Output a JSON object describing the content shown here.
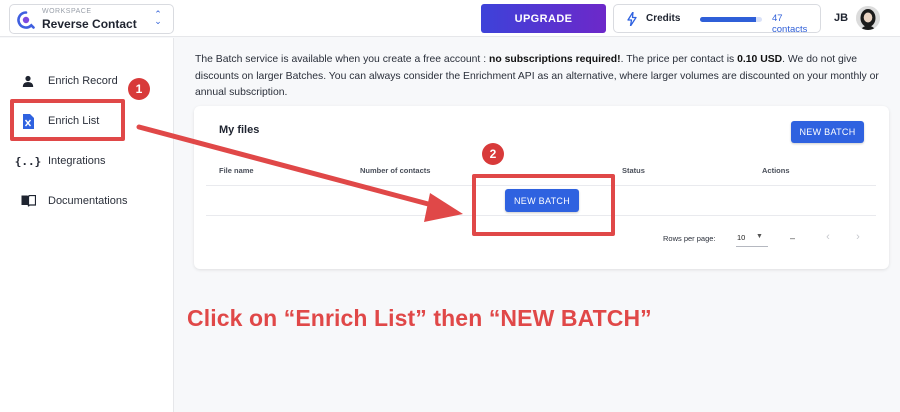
{
  "header": {
    "workspace_label": "WORKSPACE",
    "workspace_name": "Reverse Contact",
    "upgrade_label": "UPGRADE",
    "credits_label": "Credits",
    "credits_count": "47 contacts",
    "credits_progress": 0.9,
    "user_initials": "JB"
  },
  "sidebar": {
    "items": [
      {
        "label": "Enrich Record",
        "icon": "person-icon"
      },
      {
        "label": "Enrich List",
        "icon": "spreadsheet-icon"
      },
      {
        "label": "Integrations",
        "icon": "code-braces-icon"
      },
      {
        "label": "Documentations",
        "icon": "book-icon"
      }
    ]
  },
  "notice": {
    "part1": "The Batch service is available when you create a free account : ",
    "bold1": "no subscriptions required!",
    "part2": ". The price per contact is ",
    "bold2": "0.10 USD",
    "part3": ". We do not give discounts on larger Batches. You can always consider the Enrichment API as an alternative, where larger volumes are discounted on your monthly or annual subscription."
  },
  "files_card": {
    "title": "My files",
    "new_batch_label": "NEW BATCH",
    "columns": [
      "File name",
      "Number of contacts",
      "Status",
      "Actions"
    ],
    "empty_new_batch_label": "NEW BATCH",
    "rows_per_page_label": "Rows per page:",
    "rows_per_page_value": "10",
    "range_text": "–",
    "prev_label": "‹",
    "next_label": "›"
  },
  "annotations": {
    "step1": "1",
    "step2": "2",
    "caption": "Click on “Enrich List” then “NEW BATCH”"
  },
  "colors": {
    "accent": "#2f62e0",
    "annotation_red": "#e04848",
    "upgrade_gradient_start": "#3d42d9",
    "upgrade_gradient_end": "#6d28c9"
  }
}
